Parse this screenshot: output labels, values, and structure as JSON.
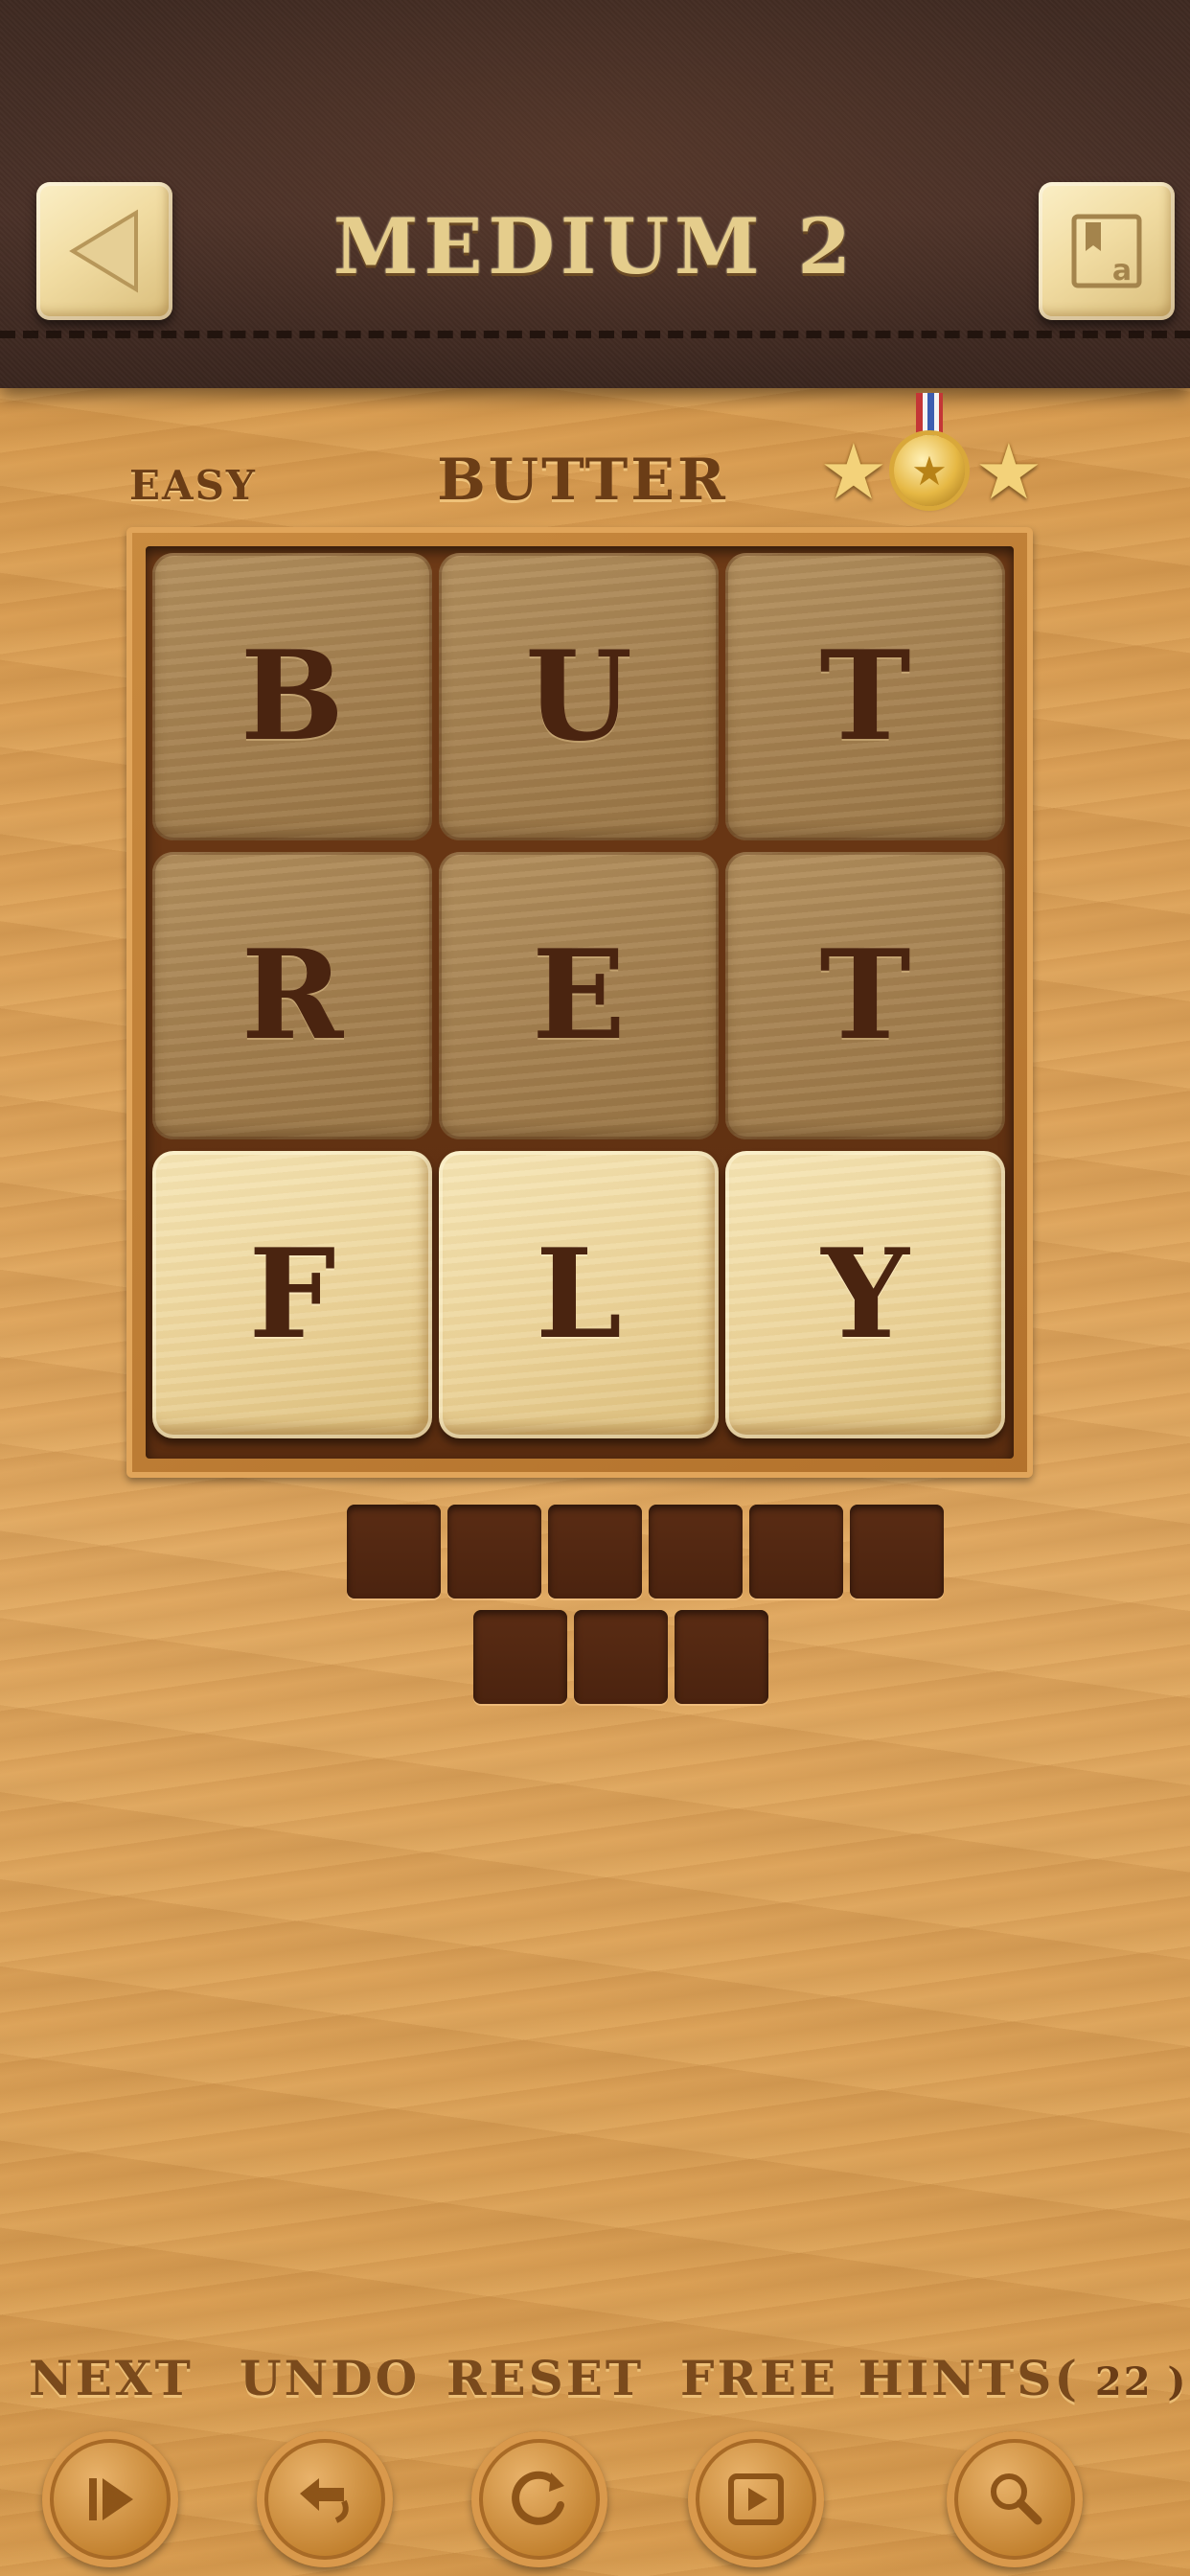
{
  "header": {
    "title": "MEDIUM 2",
    "back_icon": "back-triangle-icon",
    "dictionary_icon": "dictionary-icon"
  },
  "info": {
    "difficulty": "EASY",
    "current_word": "BUTTER",
    "stars_earned": 3,
    "stars_total": 3
  },
  "board": {
    "rows": [
      [
        {
          "letter": "B",
          "state": "used"
        },
        {
          "letter": "U",
          "state": "used"
        },
        {
          "letter": "T",
          "state": "used"
        }
      ],
      [
        {
          "letter": "R",
          "state": "used"
        },
        {
          "letter": "E",
          "state": "used"
        },
        {
          "letter": "T",
          "state": "used"
        }
      ],
      [
        {
          "letter": "F",
          "state": "free"
        },
        {
          "letter": "L",
          "state": "free"
        },
        {
          "letter": "Y",
          "state": "free"
        }
      ]
    ]
  },
  "answer": {
    "slots_row1": 6,
    "slots_row2": 3
  },
  "toolbar": {
    "next_label": "NEXT",
    "undo_label": "UNDO",
    "reset_label": "RESET",
    "free_hints_label": "FREE HINTS(",
    "hints_count": " 22 )",
    "next_icon": "skip-next-icon",
    "undo_icon": "undo-icon",
    "reset_icon": "reset-icon",
    "free_hints_icon": "play-video-icon",
    "hint_icon": "magnifier-icon"
  }
}
